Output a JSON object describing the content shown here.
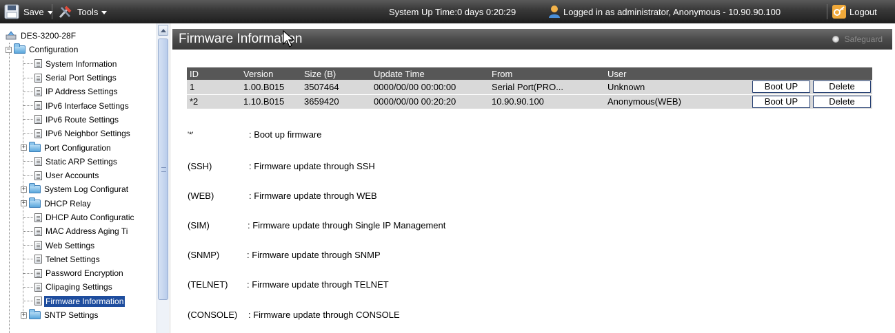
{
  "toolbar": {
    "save_label": "Save",
    "tools_label": "Tools",
    "status_text": "System Up Time:0 days 0:20:29",
    "login_text": "Logged in as administrator, Anonymous - 10.90.90.100",
    "logout_label": "Logout"
  },
  "tree": {
    "root": "DES-3200-28F",
    "configuration": "Configuration",
    "items": [
      {
        "label": "System Information",
        "type": "page"
      },
      {
        "label": "Serial Port Settings",
        "type": "page"
      },
      {
        "label": "IP Address Settings",
        "type": "page"
      },
      {
        "label": "IPv6 Interface Settings",
        "type": "page"
      },
      {
        "label": "IPv6 Route Settings",
        "type": "page"
      },
      {
        "label": "IPv6 Neighbor Settings",
        "type": "page"
      },
      {
        "label": "Port Configuration",
        "type": "folder"
      },
      {
        "label": "Static ARP Settings",
        "type": "page"
      },
      {
        "label": "User Accounts",
        "type": "page"
      },
      {
        "label": "System Log Configurat",
        "type": "folder"
      },
      {
        "label": "DHCP Relay",
        "type": "folder"
      },
      {
        "label": "DHCP Auto Configuratic",
        "type": "page"
      },
      {
        "label": "MAC Address Aging Ti",
        "type": "page"
      },
      {
        "label": "Web Settings",
        "type": "page"
      },
      {
        "label": "Telnet Settings",
        "type": "page"
      },
      {
        "label": "Password Encryption",
        "type": "page"
      },
      {
        "label": "Clipaging Settings",
        "type": "page"
      },
      {
        "label": "Firmware Information",
        "type": "page",
        "selected": true
      },
      {
        "label": "SNTP Settings",
        "type": "folder"
      }
    ]
  },
  "main": {
    "title": "Firmware Information",
    "safeguard_label": "Safeguard",
    "table": {
      "headers": [
        "ID",
        "Version",
        "Size (B)",
        "Update Time",
        "From",
        "User"
      ],
      "rows": [
        {
          "id": "1",
          "version": "1.00.B015",
          "size": "3507464",
          "update_time": "0000/00/00 00:00:00",
          "from": "Serial Port(PRO...",
          "user": "Unknown"
        },
        {
          "id": "*2",
          "version": "1.10.B015",
          "size": "3659420",
          "update_time": "0000/00/00 00:20:20",
          "from": "10.90.90.100",
          "user": "Anonymous(WEB)"
        }
      ],
      "boot_up_label": "Boot UP",
      "delete_label": "Delete"
    },
    "legend": [
      {
        "key": "'*'",
        "desc": ": Boot up firmware"
      },
      {
        "key": "(SSH)",
        "desc": ": Firmware update through SSH"
      },
      {
        "key": "(WEB)",
        "desc": ": Firmware update through WEB"
      },
      {
        "key": "(SIM)",
        "desc": ": Firmware update through Single IP Management"
      },
      {
        "key": "(SNMP)",
        "desc": ": Firmware update through SNMP"
      },
      {
        "key": "(TELNET)",
        "desc": ": Firmware update through TELNET"
      },
      {
        "key": "(CONSOLE)",
        "desc": ": Firmware update through CONSOLE"
      }
    ]
  },
  "colors": {
    "toolbar_bg": "#2b2b2b",
    "title_bg": "#4b4b4b",
    "table_header_bg": "#575757",
    "table_row_bg": "#d9d9d9",
    "selected_bg": "#1e4d9e"
  }
}
